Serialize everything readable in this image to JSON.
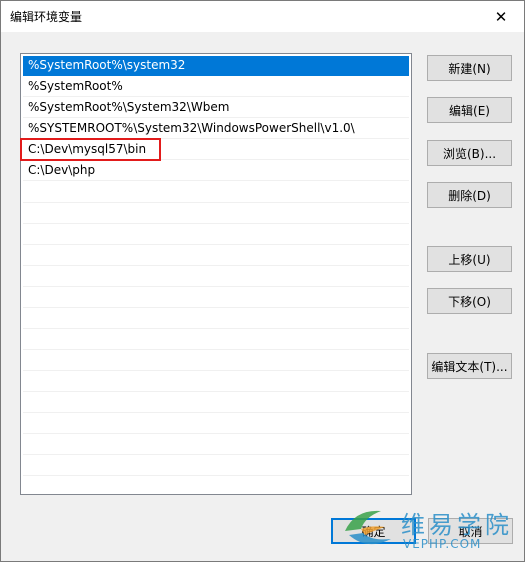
{
  "window": {
    "title": "编辑环境变量",
    "close_glyph": "✕"
  },
  "list": {
    "items": [
      {
        "label": "%SystemRoot%\\system32",
        "selected": true
      },
      {
        "label": "%SystemRoot%",
        "selected": false
      },
      {
        "label": "%SystemRoot%\\System32\\Wbem",
        "selected": false
      },
      {
        "label": "%SYSTEMROOT%\\System32\\WindowsPowerShell\\v1.0\\",
        "selected": false
      },
      {
        "label": "C:\\Dev\\mysql57\\bin",
        "selected": false,
        "highlighted": true
      },
      {
        "label": "C:\\Dev\\php",
        "selected": false
      }
    ]
  },
  "buttons": {
    "new": "新建(N)",
    "edit": "编辑(E)",
    "browse": "浏览(B)...",
    "delete": "删除(D)",
    "move_up": "上移(U)",
    "move_down": "下移(O)",
    "edit_text": "编辑文本(T)...",
    "ok": "确定",
    "cancel": "取消"
  },
  "watermark": {
    "text": "维易学院",
    "url": "VEPHP.COM"
  },
  "colors": {
    "selection": "#0078d7",
    "highlight_box": "#e21b1b",
    "watermark": "#2a8fc9"
  }
}
